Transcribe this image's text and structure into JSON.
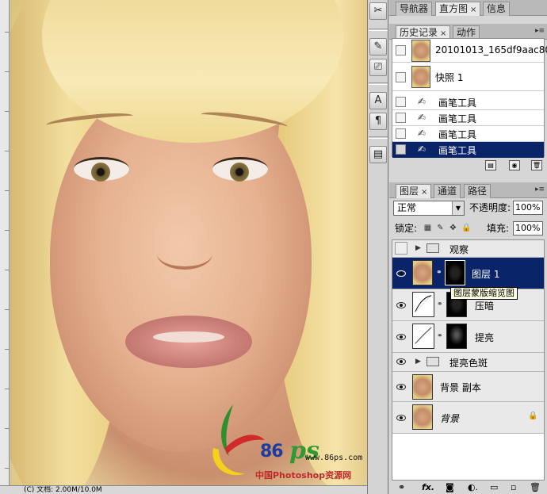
{
  "status": {
    "text": "(C) 文档: 2.00M/10.0M"
  },
  "watermark": {
    "number": "86",
    "ps": "ps",
    "url": "www.86ps.com",
    "site": "中国Photoshop资源网"
  },
  "nav_panel": {
    "tabs": [
      "导航器",
      "直方图",
      "信息"
    ],
    "close": "×"
  },
  "history_panel": {
    "tabs": [
      "历史记录",
      "动作"
    ],
    "close": "×",
    "snapshot_label": "20101013_165df9aac807...",
    "snapshot_1": "快照 1",
    "steps": [
      "画笔工具",
      "画笔工具",
      "画笔工具",
      "画笔工具"
    ]
  },
  "layers_panel": {
    "tabs": [
      "图层",
      "通道",
      "路径"
    ],
    "close": "×",
    "blend_mode": "正常",
    "opacity_label": "不透明度:",
    "opacity_value": "100%",
    "lock_label": "锁定:",
    "fill_label": "填充:",
    "fill_value": "100%",
    "layers": [
      {
        "name": "观察",
        "type": "group",
        "visible": false
      },
      {
        "name": "图层 1",
        "type": "layer-mask",
        "visible": true,
        "selected": true
      },
      {
        "name": "压暗",
        "type": "curves",
        "visible": true
      },
      {
        "name": "提亮",
        "type": "curves",
        "visible": true
      },
      {
        "name": "提亮色斑",
        "type": "group",
        "visible": true
      },
      {
        "name": "背景 副本",
        "type": "layer",
        "visible": true
      },
      {
        "name": "背景",
        "type": "background",
        "visible": true
      }
    ],
    "tooltip": "图层蒙版缩览图",
    "footer": {
      "link": "⚭",
      "fx": "fx.",
      "mask": "◙",
      "adjust": "◐.",
      "group": "▭",
      "new": "▫",
      "trash": "🗑"
    }
  },
  "tools": [
    "✂",
    "✎",
    "⎚",
    "A",
    "¶",
    "▤"
  ],
  "colors": {
    "selection": "#0a246a",
    "panel": "#d6d6d6"
  }
}
